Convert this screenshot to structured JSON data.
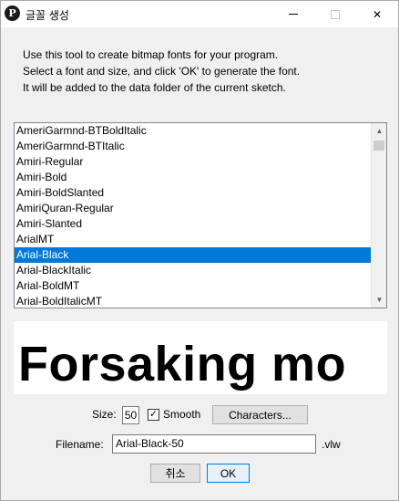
{
  "window": {
    "title": "글꼴 생성",
    "app_icon_glyph": "P",
    "controls": {
      "minimize": "minimize-icon",
      "maximize": "maximize-icon",
      "close": "close-icon",
      "close_glyph": "✕"
    }
  },
  "description": [
    "Use this tool to create bitmap fonts for your program.",
    "Select a font and size, and click 'OK' to generate the font.",
    "It will be added to the data folder of the current sketch."
  ],
  "font_list": {
    "items": [
      "AmeriGarmnd-BTBoldItalic",
      "AmeriGarmnd-BTItalic",
      "Amiri-Regular",
      "Amiri-Bold",
      "Amiri-BoldSlanted",
      "AmiriQuran-Regular",
      "Amiri-Slanted",
      "ArialMT",
      "Arial-Black",
      "Arial-BlackItalic",
      "Arial-BoldMT",
      "Arial-BoldItalicMT"
    ],
    "selected": "Arial-Black",
    "scroll_position": 0.05
  },
  "preview": {
    "text": "Forsaking mo"
  },
  "size": {
    "label": "Size:",
    "value": "50"
  },
  "smooth": {
    "label": "Smooth",
    "checked": true,
    "check_glyph": "✓"
  },
  "characters_button": "Characters...",
  "filename": {
    "label": "Filename:",
    "value": "Arial-Black-50",
    "extension": ".vlw"
  },
  "buttons": {
    "cancel": "취소",
    "ok": "OK"
  },
  "colors": {
    "selection": "#0078d7",
    "window_bg": "#f0f0f0"
  }
}
